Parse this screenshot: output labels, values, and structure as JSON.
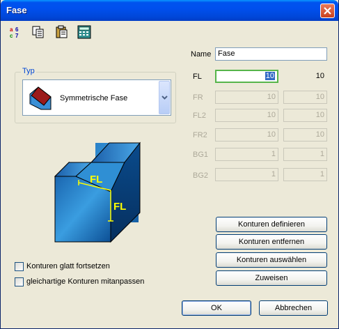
{
  "window": {
    "title": "Fase"
  },
  "toolbar": {
    "icons": [
      "sort-icon",
      "copy-icon",
      "paste-icon",
      "calculator-icon"
    ]
  },
  "typ": {
    "legend": "Typ",
    "selected": "Symmetrische Fase"
  },
  "illustration": {
    "label_top": "FL",
    "label_side": "FL"
  },
  "fields": {
    "name": {
      "label": "Name",
      "value": "Fase"
    },
    "fl": {
      "label": "FL",
      "value": "10",
      "readout": "10"
    },
    "fr": {
      "label": "FR",
      "value": "10",
      "readout": "10"
    },
    "fl2": {
      "label": "FL2",
      "value": "10",
      "readout": "10"
    },
    "fr2": {
      "label": "FR2",
      "value": "10",
      "readout": "10"
    },
    "bg1": {
      "label": "BG1",
      "value": "1",
      "readout": "1"
    },
    "bg2": {
      "label": "BG2",
      "value": "1",
      "readout": "1"
    }
  },
  "buttons": {
    "konturen_definieren": "Konturen definieren",
    "konturen_entfernen": "Konturen entfernen",
    "konturen_auswaehlen": "Konturen auswählen",
    "zuweisen": "Zuweisen",
    "ok": "OK",
    "abbrechen": "Abbrechen"
  },
  "checkboxes": {
    "glatt": {
      "label": "Konturen glatt fortsetzen",
      "checked": false
    },
    "gleichartig": {
      "label": "gleichartige Konturen mitanpassen",
      "checked": false
    }
  }
}
